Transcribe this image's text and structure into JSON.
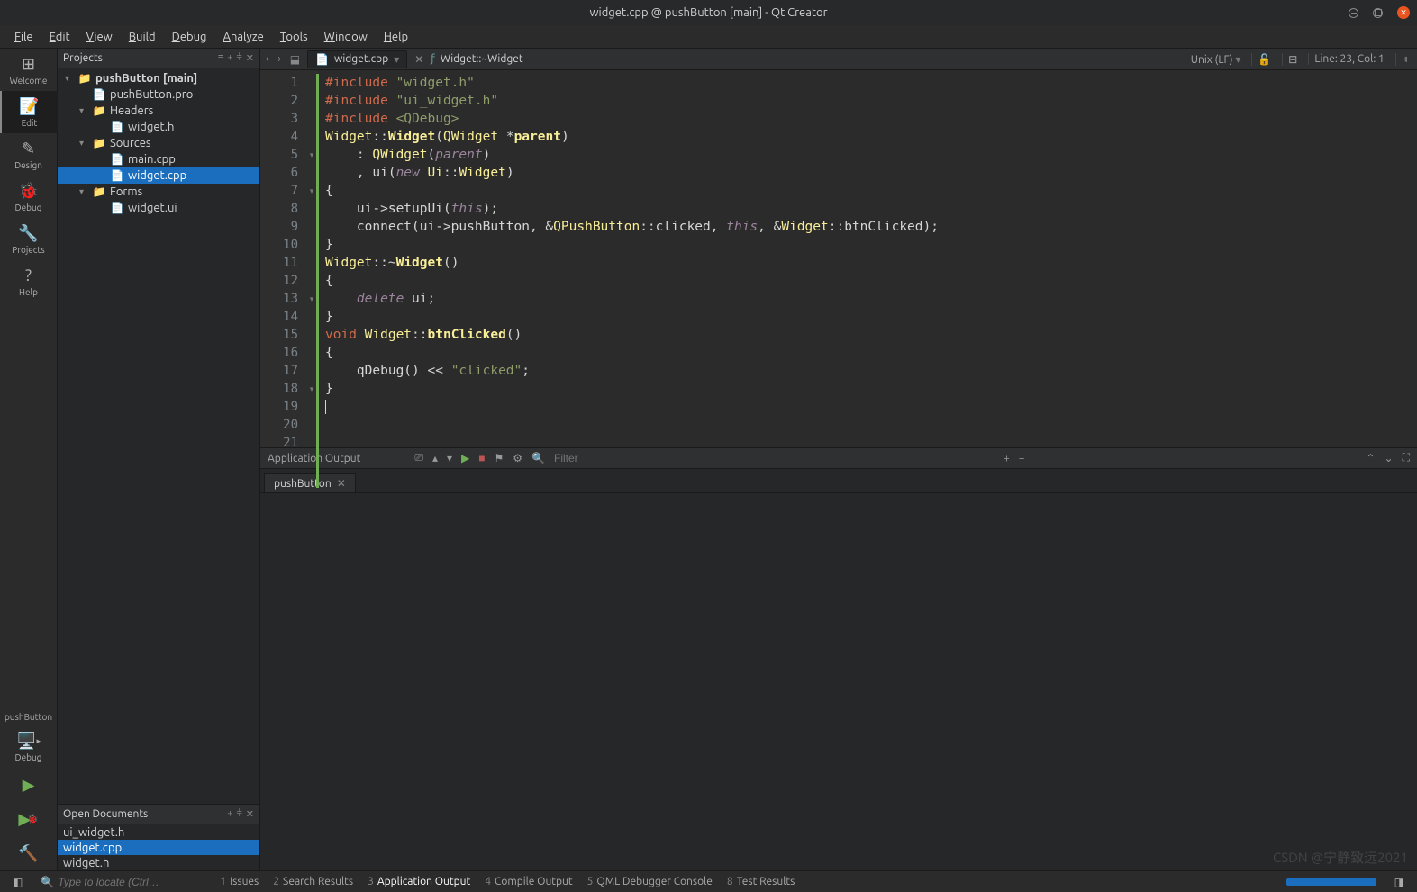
{
  "window": {
    "title": "widget.cpp @ pushButton [main] - Qt Creator"
  },
  "menu": [
    "File",
    "Edit",
    "View",
    "Build",
    "Debug",
    "Analyze",
    "Tools",
    "Window",
    "Help"
  ],
  "rail": {
    "items": [
      {
        "label": "Welcome",
        "icon": "⊞"
      },
      {
        "label": "Edit",
        "icon": "📝",
        "active": true
      },
      {
        "label": "Design",
        "icon": "✎"
      },
      {
        "label": "Debug",
        "icon": "🐞"
      },
      {
        "label": "Projects",
        "icon": "🔧"
      },
      {
        "label": "Help",
        "icon": "?"
      }
    ],
    "target": "pushButton",
    "mode": "Debug",
    "buttons": [
      {
        "name": "run",
        "glyph": "▶",
        "color": "#6fae54"
      },
      {
        "name": "debug-run",
        "glyph": "▶",
        "color": "#6fae54",
        "badge": true
      },
      {
        "name": "build",
        "glyph": "🔨",
        "color": "#c8875a"
      }
    ]
  },
  "projects": {
    "header": "Projects",
    "tree": [
      {
        "l": 0,
        "arrow": "▾",
        "ico": "📁",
        "label": "pushButton [main]",
        "bold": true
      },
      {
        "l": 1,
        "arrow": "",
        "ico": "📄",
        "label": "pushButton.pro"
      },
      {
        "l": 1,
        "arrow": "▾",
        "ico": "📁",
        "label": "Headers"
      },
      {
        "l": 2,
        "arrow": "",
        "ico": "📄",
        "label": "widget.h"
      },
      {
        "l": 1,
        "arrow": "▾",
        "ico": "📁",
        "label": "Sources"
      },
      {
        "l": 2,
        "arrow": "",
        "ico": "📄",
        "label": "main.cpp"
      },
      {
        "l": 2,
        "arrow": "",
        "ico": "📄",
        "label": "widget.cpp",
        "sel": true
      },
      {
        "l": 1,
        "arrow": "▾",
        "ico": "📁",
        "label": "Forms"
      },
      {
        "l": 2,
        "arrow": "",
        "ico": "📄",
        "label": "widget.ui"
      }
    ]
  },
  "openDocs": {
    "header": "Open Documents",
    "items": [
      {
        "label": "ui_widget.h"
      },
      {
        "label": "widget.cpp",
        "sel": true
      },
      {
        "label": "widget.h"
      }
    ]
  },
  "editorBar": {
    "file": "widget.cpp",
    "symbol": "Widget::~Widget",
    "encoding": "Unix (LF)",
    "cursor": "Line: 23, Col: 1"
  },
  "code": {
    "lines": 23,
    "currentLine": 23,
    "foldable": [
      5,
      7,
      13,
      18
    ]
  },
  "output": {
    "title": "Application Output",
    "filterPlaceholder": "Filter",
    "tab": "pushButton"
  },
  "status": {
    "locatorPlaceholder": "Type to locate (Ctrl…",
    "panes": [
      {
        "n": "1",
        "label": "Issues"
      },
      {
        "n": "2",
        "label": "Search Results"
      },
      {
        "n": "3",
        "label": "Application Output",
        "active": true
      },
      {
        "n": "4",
        "label": "Compile Output"
      },
      {
        "n": "5",
        "label": "QML Debugger Console"
      },
      {
        "n": "8",
        "label": "Test Results"
      }
    ]
  },
  "watermark": "CSDN @宁静致远2021"
}
